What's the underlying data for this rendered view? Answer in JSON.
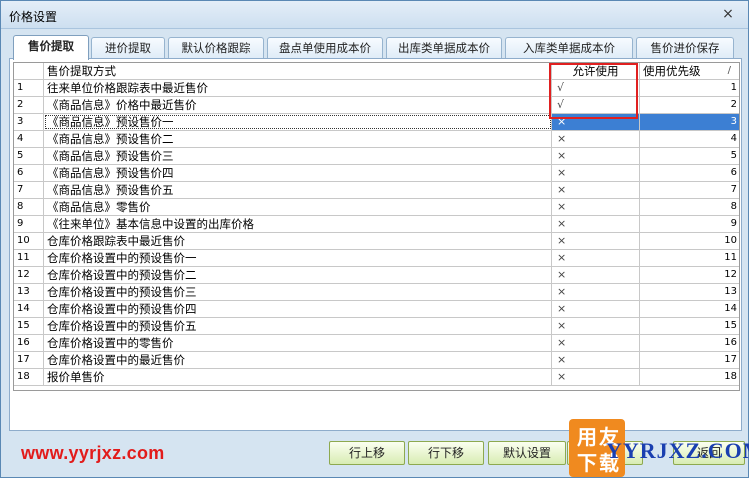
{
  "window": {
    "title": "价格设置",
    "close_label": "×"
  },
  "tabs": [
    {
      "label": "售价提取",
      "active": true
    },
    {
      "label": "进价提取"
    },
    {
      "label": "默认价格跟踪"
    },
    {
      "label": "盘点单使用成本价"
    },
    {
      "label": "出库类单据成本价"
    },
    {
      "label": "入库类单据成本价"
    },
    {
      "label": "售价进价保存"
    }
  ],
  "grid": {
    "headers": {
      "no": "",
      "name": "售价提取方式",
      "allow": "允许使用",
      "priority": "使用优先级",
      "sort_mark": "/"
    },
    "rows": [
      {
        "no": "1",
        "name": "往来单位价格跟踪表中最近售价",
        "allow": "√",
        "priority": "1"
      },
      {
        "no": "2",
        "name": "《商品信息》价格中最近售价",
        "allow": "√",
        "priority": "2"
      },
      {
        "no": "3",
        "name": "《商品信息》预设售价一",
        "allow": "×",
        "priority": "3",
        "selected": true
      },
      {
        "no": "4",
        "name": "《商品信息》预设售价二",
        "allow": "×",
        "priority": "4"
      },
      {
        "no": "5",
        "name": "《商品信息》预设售价三",
        "allow": "×",
        "priority": "5"
      },
      {
        "no": "6",
        "name": "《商品信息》预设售价四",
        "allow": "×",
        "priority": "6"
      },
      {
        "no": "7",
        "name": "《商品信息》预设售价五",
        "allow": "×",
        "priority": "7"
      },
      {
        "no": "8",
        "name": "《商品信息》零售价",
        "allow": "×",
        "priority": "8"
      },
      {
        "no": "9",
        "name": "《往来单位》基本信息中设置的出库价格",
        "allow": "×",
        "priority": "9"
      },
      {
        "no": "10",
        "name": "仓库价格跟踪表中最近售价",
        "allow": "×",
        "priority": "10"
      },
      {
        "no": "11",
        "name": "仓库价格设置中的预设售价一",
        "allow": "×",
        "priority": "11"
      },
      {
        "no": "12",
        "name": "仓库价格设置中的预设售价二",
        "allow": "×",
        "priority": "12"
      },
      {
        "no": "13",
        "name": "仓库价格设置中的预设售价三",
        "allow": "×",
        "priority": "13"
      },
      {
        "no": "14",
        "name": "仓库价格设置中的预设售价四",
        "allow": "×",
        "priority": "14"
      },
      {
        "no": "15",
        "name": "仓库价格设置中的预设售价五",
        "allow": "×",
        "priority": "15"
      },
      {
        "no": "16",
        "name": "仓库价格设置中的零售价",
        "allow": "×",
        "priority": "16"
      },
      {
        "no": "17",
        "name": "仓库价格设置中的最近售价",
        "allow": "×",
        "priority": "17"
      },
      {
        "no": "18",
        "name": "报价单售价",
        "allow": "×",
        "priority": "18"
      }
    ]
  },
  "watermark": {
    "url": "www.yyrjxz.com",
    "logo_chars": [
      "用",
      "友",
      "下",
      "载"
    ],
    "logo_text": "YYRJXZ.COM"
  },
  "buttons": {
    "move_up": "行上移",
    "move_down": "行下移",
    "default_settings": "默认设置",
    "save": "保存",
    "back": "返回"
  },
  "colors": {
    "accent": "#3c7fd3",
    "highlight": "#e02020",
    "watermark": "#e21b1b"
  }
}
